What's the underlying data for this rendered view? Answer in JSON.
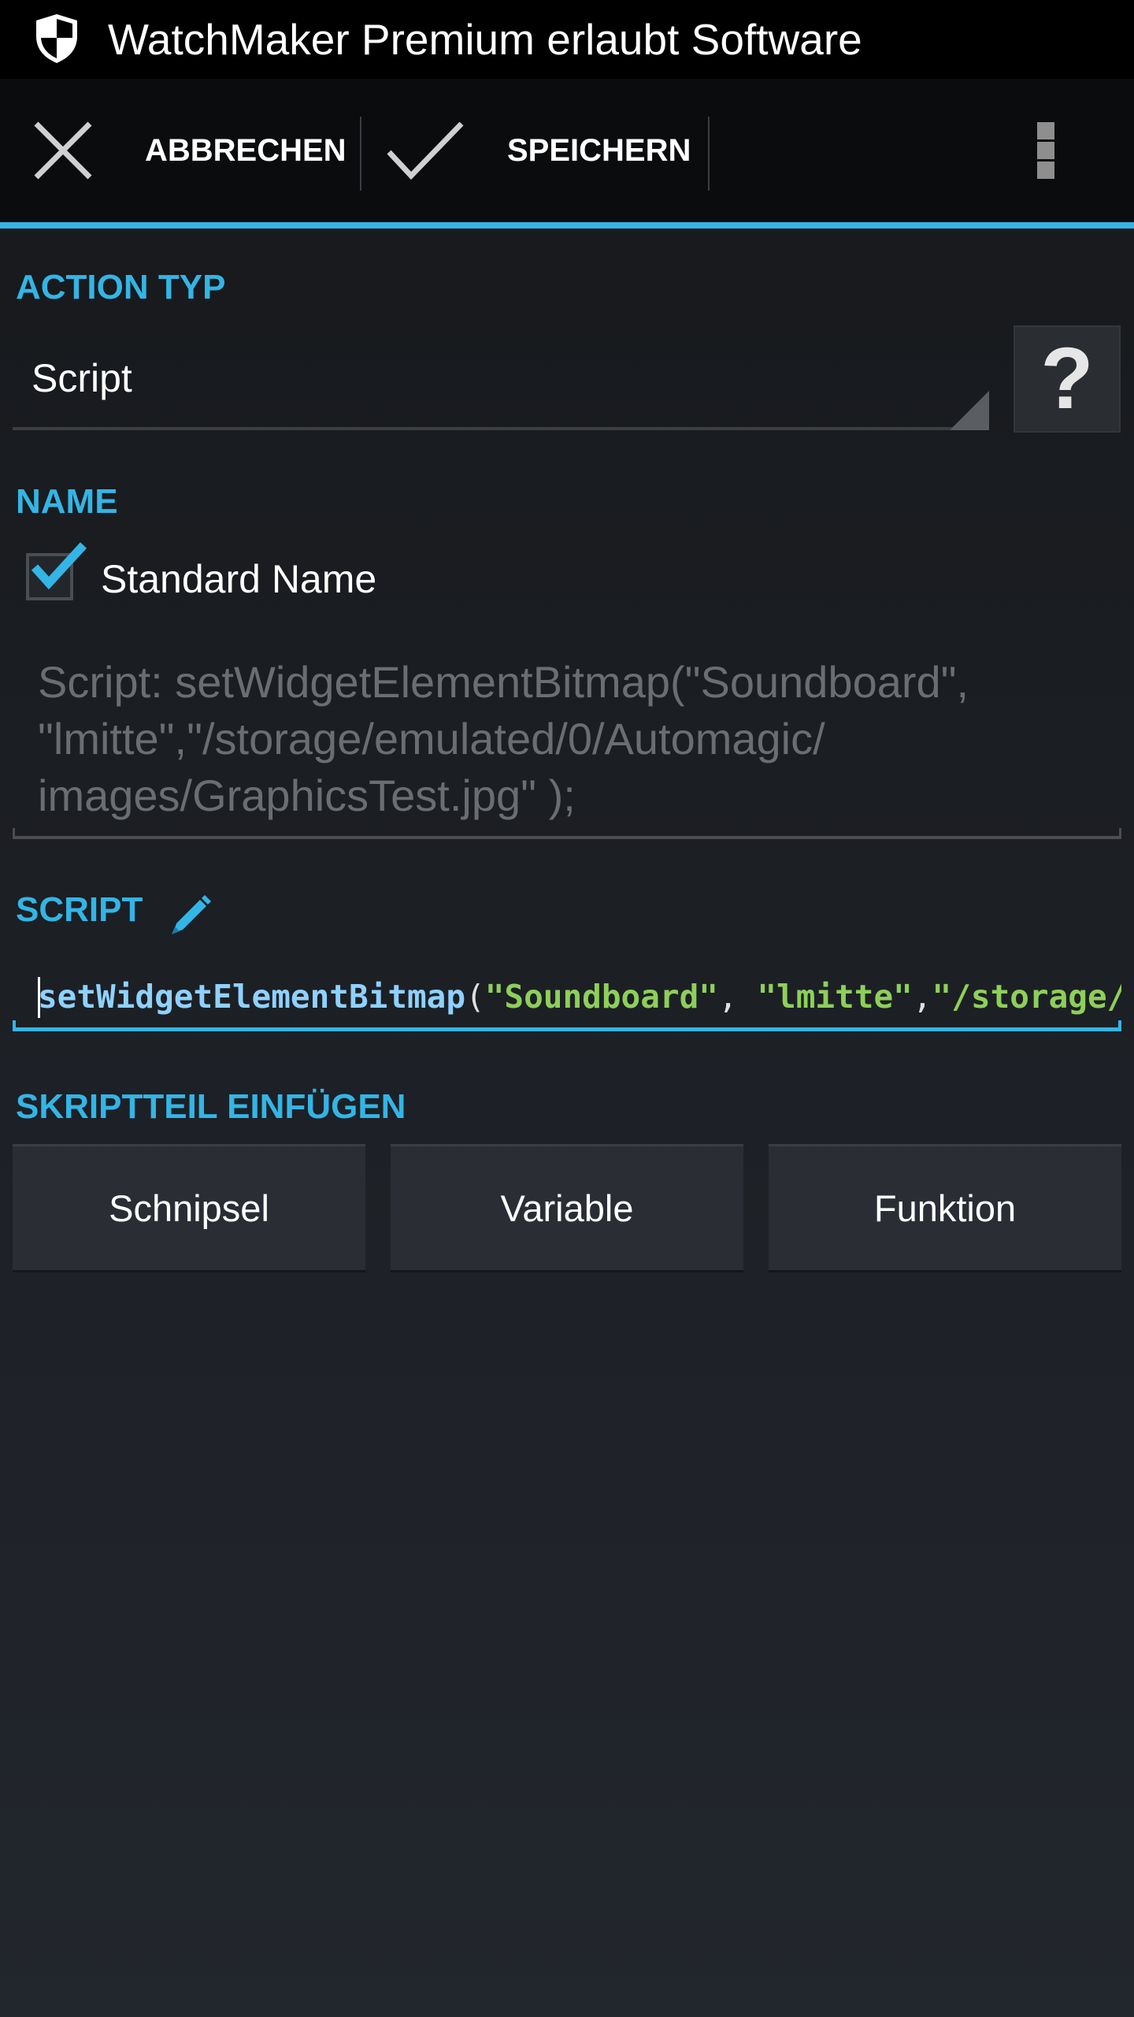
{
  "status_bar": {
    "notification_text": "WatchMaker Premium erlaubt Software",
    "icon": "shield-icon"
  },
  "action_bar": {
    "cancel_label": "ABBRECHEN",
    "cancel_icon": "close-icon",
    "save_label": "SPEICHERN",
    "save_icon": "checkmark-icon",
    "overflow_icon": "overflow-menu-icon"
  },
  "action_type": {
    "header": "ACTION TYP",
    "selected_value": "Script",
    "help_label": "?"
  },
  "name_section": {
    "header": "NAME",
    "checkbox_label": "Standard Name",
    "checkbox_checked": true,
    "name_value": "Script: setWidgetElementBitmap(\"Soundboard\",\n\"lmitte\",\"/storage/emulated/0/Automagic/\nimages/GraphicsTest.jpg\" );"
  },
  "script_section": {
    "header": "SCRIPT",
    "edit_icon": "pencil-icon",
    "code_function": "setWidgetElementBitmap",
    "code_open_paren": "(",
    "code_arg1": "\"Soundboard\"",
    "code_sep1": ", ",
    "code_arg2": "\"lmitte\"",
    "code_sep2": ",",
    "code_arg3": "\"/storage/"
  },
  "insert_section": {
    "header": "SKRIPTTEIL EINFÜGEN",
    "buttons": [
      "Schnipsel",
      "Variable",
      "Funktion"
    ]
  },
  "colors": {
    "accent": "#33b5e5",
    "code_function": "#8fd1ff",
    "code_string": "#8ecf5a",
    "background": "#1c1f24"
  }
}
